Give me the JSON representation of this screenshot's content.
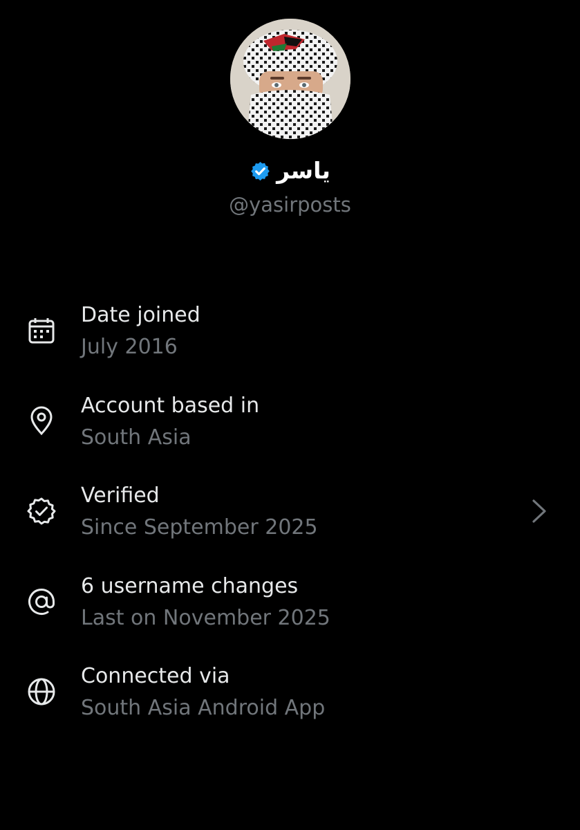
{
  "profile": {
    "display_name": "ياسر",
    "handle": "@yasirposts",
    "verified_badge_icon": "verified-badge-icon",
    "verified_badge_color": "#1d9bf0"
  },
  "about": {
    "items": [
      {
        "icon": "calendar-icon",
        "title": "Date joined",
        "subtitle": "July 2016"
      },
      {
        "icon": "location-pin-icon",
        "title": "Account based in",
        "subtitle": "South Asia"
      },
      {
        "icon": "verified-outline-icon",
        "title": "Verified",
        "subtitle": "Since September 2025",
        "has_chevron": true
      },
      {
        "icon": "at-sign-icon",
        "title": "6 username changes",
        "subtitle": "Last on November 2025"
      },
      {
        "icon": "globe-icon",
        "title": "Connected via",
        "subtitle": "South Asia Android App"
      }
    ]
  },
  "colors": {
    "background": "#000000",
    "primary_text": "#e7e9ea",
    "secondary_text": "#71767b",
    "accent": "#1d9bf0"
  }
}
